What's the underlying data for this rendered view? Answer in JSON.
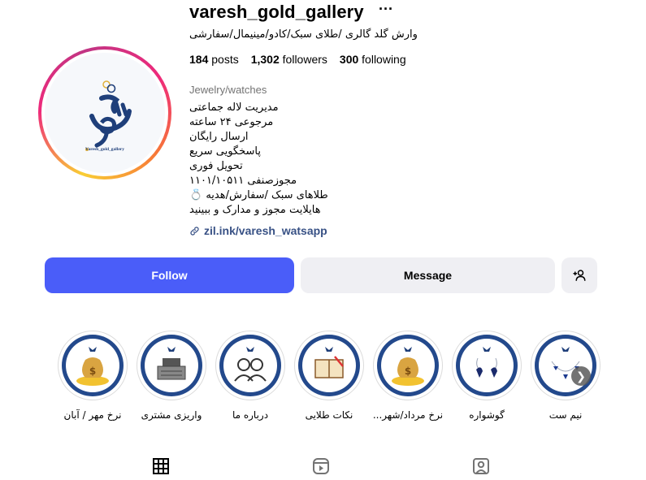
{
  "profile": {
    "username": "varesh_gold_gallery",
    "full_name": "وارش گلد گالری /طلای سبک/کادو/مینیمال/سفارشی",
    "avatar_text": "Varesh_gold_gallery",
    "stats": {
      "posts_count": "184",
      "posts_label": "posts",
      "followers_count": "1,302",
      "followers_label": "followers",
      "following_count": "300",
      "following_label": "following"
    },
    "category": "Jewelry/watches",
    "bio_lines": [
      "مدیریت لاله جماعتی",
      "مرجوعی ۲۴ ساعته",
      "ارسال رایگان",
      "پاسخگویی سریع",
      "تحویل فوری",
      "مجوزصنفی ۱۱۰۱/۱۰۵۱۱",
      "طلاهای سبک /سفارش/هدیه 💍",
      "هایلایت مجوز و مدارک و ببینید"
    ],
    "link": "zil.ink/varesh_watsapp"
  },
  "actions": {
    "follow": "Follow",
    "message": "Message"
  },
  "highlights": [
    {
      "label": "نیم ست",
      "icon": "necklace-icon"
    },
    {
      "label": "گوشواره",
      "icon": "earrings-icon"
    },
    {
      "label": "نرخ مرداد/شهر...",
      "icon": "money-bag-icon"
    },
    {
      "label": "نکات طلایی",
      "icon": "book-icon"
    },
    {
      "label": "درباره ما",
      "icon": "people-icon"
    },
    {
      "label": "واریزی مشتری",
      "icon": "cash-register-icon"
    },
    {
      "label": "نرخ مهر / آبان",
      "icon": "money-bag-icon"
    }
  ],
  "tabs": [
    "grid-icon",
    "reels-icon",
    "tagged-icon"
  ],
  "colors": {
    "follow_button": "#4a5df9",
    "secondary_button": "#efeff3",
    "link": "#385185",
    "highlight_ring": "#23498c",
    "logo_blue": "#1f3f7a",
    "gold": "#e0b03a"
  }
}
